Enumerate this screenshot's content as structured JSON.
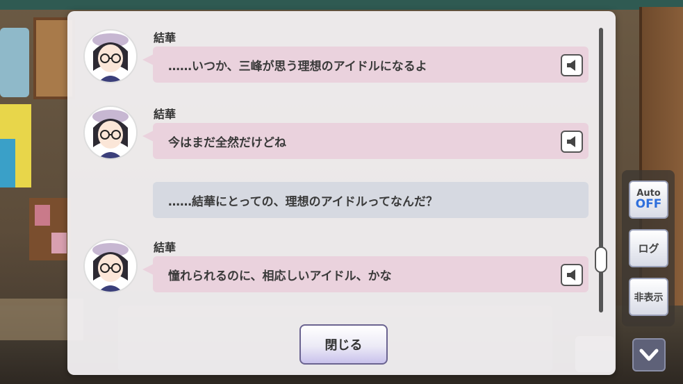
{
  "log": {
    "entries": [
      {
        "speaker": "結華",
        "text": "……いつか、三峰が思う理想のアイドルになるよ",
        "has_voice": true,
        "style": "character"
      },
      {
        "speaker": "結華",
        "text": "今はまだ全然だけどね",
        "has_voice": true,
        "style": "character"
      },
      {
        "speaker": "",
        "text": "……結華にとっての、理想のアイドルってなんだ？",
        "has_voice": false,
        "style": "producer"
      },
      {
        "speaker": "結華",
        "text": "憧れられるのに、相応しいアイドル、かな",
        "has_voice": true,
        "style": "character"
      }
    ],
    "close_label": "閉じる",
    "scroll_position": 0.85
  },
  "controls": {
    "auto_label": "Auto",
    "auto_state": "OFF",
    "log_label": "ログ",
    "hide_label": "非表示"
  },
  "icons": {
    "voice": "speaker-icon",
    "down": "chevron-down-icon"
  },
  "colors": {
    "character_bubble": "#ead2dd",
    "producer_bubble": "#d6d9e1",
    "auto_off": "#2f6fdc"
  }
}
